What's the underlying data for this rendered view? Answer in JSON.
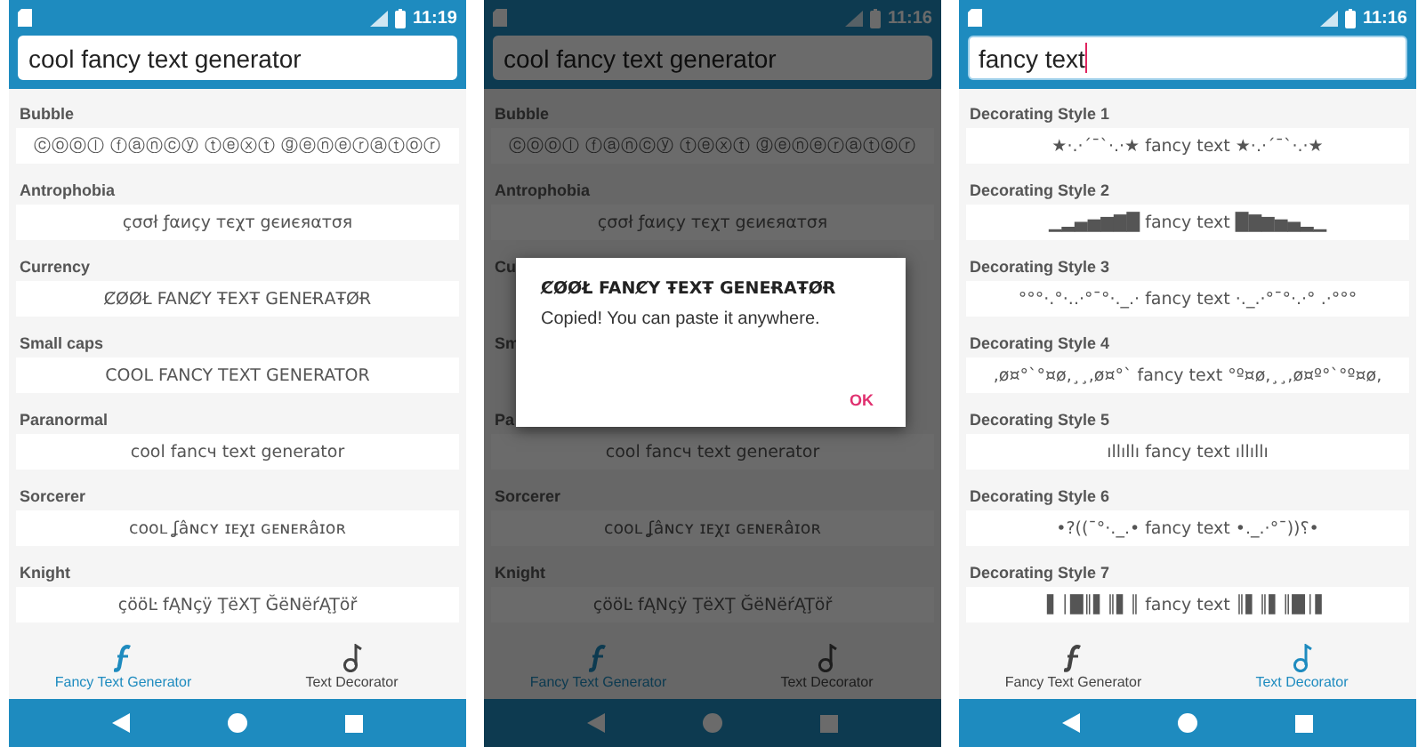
{
  "phones": [
    {
      "time": "11:19",
      "search": {
        "value": "cool fancy text generator",
        "focused": false
      },
      "dimmed": false,
      "items": [
        {
          "label": "Bubble",
          "value": "ⓒⓞⓞⓛ ⓕⓐⓝⓒⓨ ⓣⓔⓧⓣ ⓖⓔⓝⓔⓡⓐⓣⓞⓡ"
        },
        {
          "label": "Antrophobia",
          "value": "çσσł ƒαиçу тєχт gєиєяαтσя"
        },
        {
          "label": "Currency",
          "value": "ȻØØŁ FANȻY ŦEXŦ GENEɌAŦØɌ"
        },
        {
          "label": "Small caps",
          "value": "COOL FANCY TEXT GENERATOR"
        },
        {
          "label": "Paranormal",
          "value": "cool fancч text generator"
        },
        {
          "label": "Sorcerer",
          "value": "ᴄᴏᴏʟ ʆâɴᴄʏ ɪᴇχɪ ɢᴇɴᴇʀâɪᴏʀ"
        },
        {
          "label": "Knight",
          "value": "çööĿ fĄNçÿ ŢëXŢ ĞëNëŕĄŢöř"
        }
      ],
      "tabs": [
        {
          "label": "Fancy Text Generator",
          "selected": true,
          "kind": "fancy"
        },
        {
          "label": "Text Decorator",
          "selected": false,
          "kind": "decorator"
        }
      ]
    },
    {
      "time": "11:16",
      "search": {
        "value": "cool fancy text generator",
        "focused": false
      },
      "dimmed": true,
      "items": [
        {
          "label": "Bubble",
          "value": "ⓒⓞⓞⓛ ⓕⓐⓝⓒⓨ ⓣⓔⓧⓣ ⓖⓔⓝⓔⓡⓐⓣⓞⓡ"
        },
        {
          "label": "Antrophobia",
          "value": "çσσł ƒαиçу тєχт gєиєяαтσя"
        },
        {
          "label": "Cu"
        },
        {
          "label": "Sm"
        },
        {
          "label": "Pa",
          "value": "cool fancч text generator"
        },
        {
          "label": "Sorcerer",
          "value": "ᴄᴏᴏʟ ʆâɴᴄʏ ɪᴇχɪ ɢᴇɴᴇʀâɪᴏʀ"
        },
        {
          "label": "Knight",
          "value": "çööĿ fĄNçÿ ŢëXŢ ĞëNëŕĄŢöř"
        }
      ],
      "dialog": {
        "title": "ȻØØŁ FANȻY ŦEXŦ GENEɌAŦØɌ",
        "message": "Copied! You can paste it anywhere.",
        "button": "OK"
      },
      "tabs": [
        {
          "label": "Fancy Text Generator",
          "selected": true,
          "kind": "fancy"
        },
        {
          "label": "Text Decorator",
          "selected": false,
          "kind": "decorator"
        }
      ]
    },
    {
      "time": "11:16",
      "search": {
        "value": "fancy text",
        "focused": true
      },
      "dimmed": false,
      "items": [
        {
          "label": "Decorating Style 1",
          "value": "★·.·´¯`·.·★ fancy text ★·.·´¯`·.·★"
        },
        {
          "label": "Decorating Style 2",
          "value": "▁▂▄▅▆▇█ fancy text █▇▆▅▄▂▁"
        },
        {
          "label": "Decorating Style 3",
          "value": "°°°·.°·..·°¯°·._.· fancy text ·._.·°¯°·.·° .·°°°"
        },
        {
          "label": "Decorating Style 4",
          "value": ",ø¤°`°¤ø,¸¸,ø¤°` fancy text °º¤ø,¸¸,ø¤º°`°º¤ø,"
        },
        {
          "label": "Decorating Style 5",
          "value": "ıllıllı fancy text ıllıllı"
        },
        {
          "label": "Decorating Style 6",
          "value": "•?((¯°·._.• fancy text •._.·°¯))؟•"
        },
        {
          "label": "Decorating Style 7",
          "value": "▌│█║▌║▌║ fancy text ║▌║▌║█│▌"
        }
      ],
      "tabs": [
        {
          "label": "Fancy Text Generator",
          "selected": false,
          "kind": "fancy"
        },
        {
          "label": "Text Decorator",
          "selected": true,
          "kind": "decorator"
        }
      ]
    }
  ]
}
